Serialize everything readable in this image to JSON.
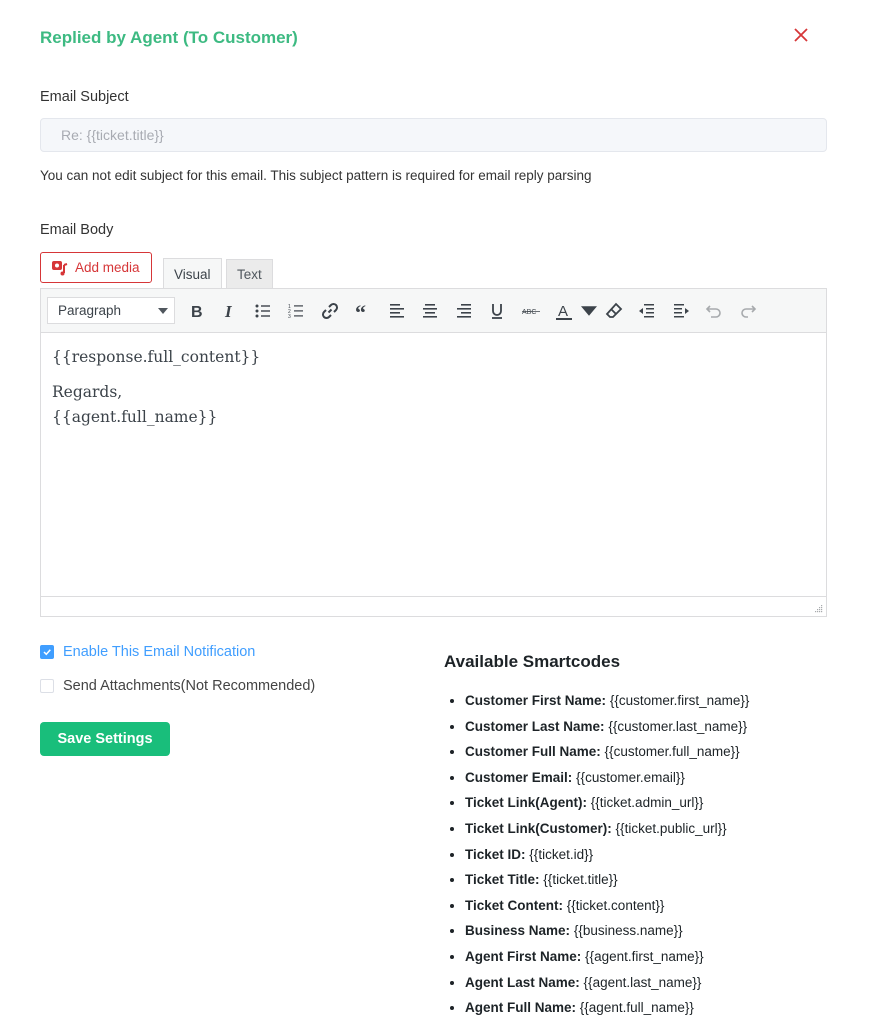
{
  "header": {
    "title": "Replied by Agent (To Customer)",
    "close_icon": "close-icon",
    "accent_color": "#3dba82",
    "close_color": "#d63638"
  },
  "subject": {
    "label": "Email Subject",
    "value": "Re: {{ticket.title}}",
    "help_text": "You can not edit subject for this email. This subject pattern is required for email reply parsing"
  },
  "body": {
    "label": "Email Body",
    "add_media_label": "Add media",
    "add_media_icon": "media-icon",
    "tabs": [
      {
        "label": "Visual",
        "active": true
      },
      {
        "label": "Text",
        "active": false
      }
    ],
    "toolbar": {
      "format_value": "Paragraph",
      "buttons": [
        "bold",
        "italic",
        "bullet-list",
        "numbered-list",
        "link",
        "blockquote",
        "align-left",
        "align-center",
        "align-right",
        "underline",
        "strikethrough",
        "text-color",
        "text-color-dropdown",
        "clear-formatting",
        "outdent",
        "indent",
        "undo",
        "redo"
      ]
    },
    "content": {
      "line1": "{{response.full_content}}",
      "line2": "Regards,",
      "line3": "{{agent.full_name}}"
    }
  },
  "options": {
    "enable_label": "Enable This Email Notification",
    "enable_checked": true,
    "attachments_label": "Send Attachments(Not Recommended)",
    "attachments_checked": false,
    "check_color": "#409eff"
  },
  "save_label": "Save Settings",
  "save_color": "#19be7b",
  "smartcodes": {
    "title": "Available Smartcodes",
    "items": [
      {
        "name": "Customer First Name:",
        "code": "{{customer.first_name}}"
      },
      {
        "name": "Customer Last Name:",
        "code": "{{customer.last_name}}"
      },
      {
        "name": "Customer Full Name:",
        "code": "{{customer.full_name}}"
      },
      {
        "name": "Customer Email:",
        "code": "{{customer.email}}"
      },
      {
        "name": "Ticket Link(Agent):",
        "code": "{{ticket.admin_url}}"
      },
      {
        "name": "Ticket Link(Customer):",
        "code": "{{ticket.public_url}}"
      },
      {
        "name": "Ticket ID:",
        "code": "{{ticket.id}}"
      },
      {
        "name": "Ticket Title:",
        "code": "{{ticket.title}}"
      },
      {
        "name": "Ticket Content:",
        "code": "{{ticket.content}}"
      },
      {
        "name": "Business Name:",
        "code": "{{business.name}}"
      },
      {
        "name": "Agent First Name:",
        "code": "{{agent.first_name}}"
      },
      {
        "name": "Agent Last Name:",
        "code": "{{agent.last_name}}"
      },
      {
        "name": "Agent Full Name:",
        "code": "{{agent.full_name}}"
      }
    ]
  }
}
